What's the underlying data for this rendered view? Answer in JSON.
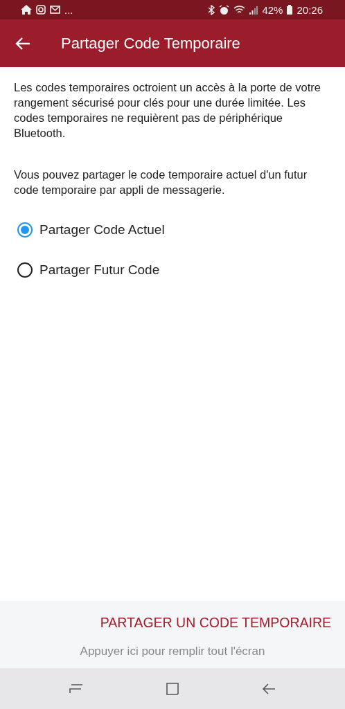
{
  "status_bar": {
    "overflow": "...",
    "battery": "42%",
    "time": "20:26"
  },
  "app_bar": {
    "title": "Partager Code Temporaire"
  },
  "paragraphs": [
    "Les codes temporaires octroient un accès à la porte de votre rangement sécurisé pour clés pour une durée limitée. Les codes temporaires ne requièrent pas de périphérique Bluetooth.",
    "Vous pouvez partager le code temporaire actuel d'un futur code temporaire par appli de messagerie."
  ],
  "options": [
    {
      "label": "Partager Code Actuel",
      "selected": true
    },
    {
      "label": "Partager Futur Code",
      "selected": false
    }
  ],
  "action_button": "PARTAGER UN CODE TEMPORAIRE",
  "fullscreen_hint": "Appuyer ici pour remplir tout l'écran"
}
